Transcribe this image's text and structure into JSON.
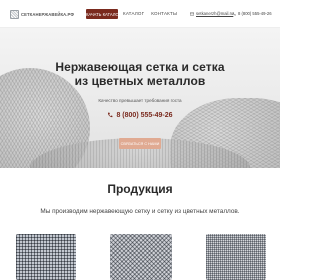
{
  "header": {
    "logo_text": "СЕТКАНЕРЖАВЕЙКА.РФ",
    "catalog_button": "СКАЧАТЬ КАТАЛОГ",
    "nav": [
      "КАТАЛОГ",
      "КОНТАКТЫ"
    ],
    "email": "setkanerzh@mail.ru",
    "phone": "8 (800) 555-49-26"
  },
  "hero": {
    "title_line1": "Нержавеющая сетка и сетка",
    "title_line2": "из цветных металлов",
    "subtitle": "Качество превышает требования госта",
    "phone": "8 (800) 555-49-26",
    "cta_button": "СВЯЗАТЬСЯ С НАМИ"
  },
  "products": {
    "title": "Продукция",
    "subtitle": "Мы производим нержавеющую сетку и сетку из цветных металлов."
  },
  "colors": {
    "accent": "#7a2a1e",
    "cta": "#e0aa92"
  }
}
